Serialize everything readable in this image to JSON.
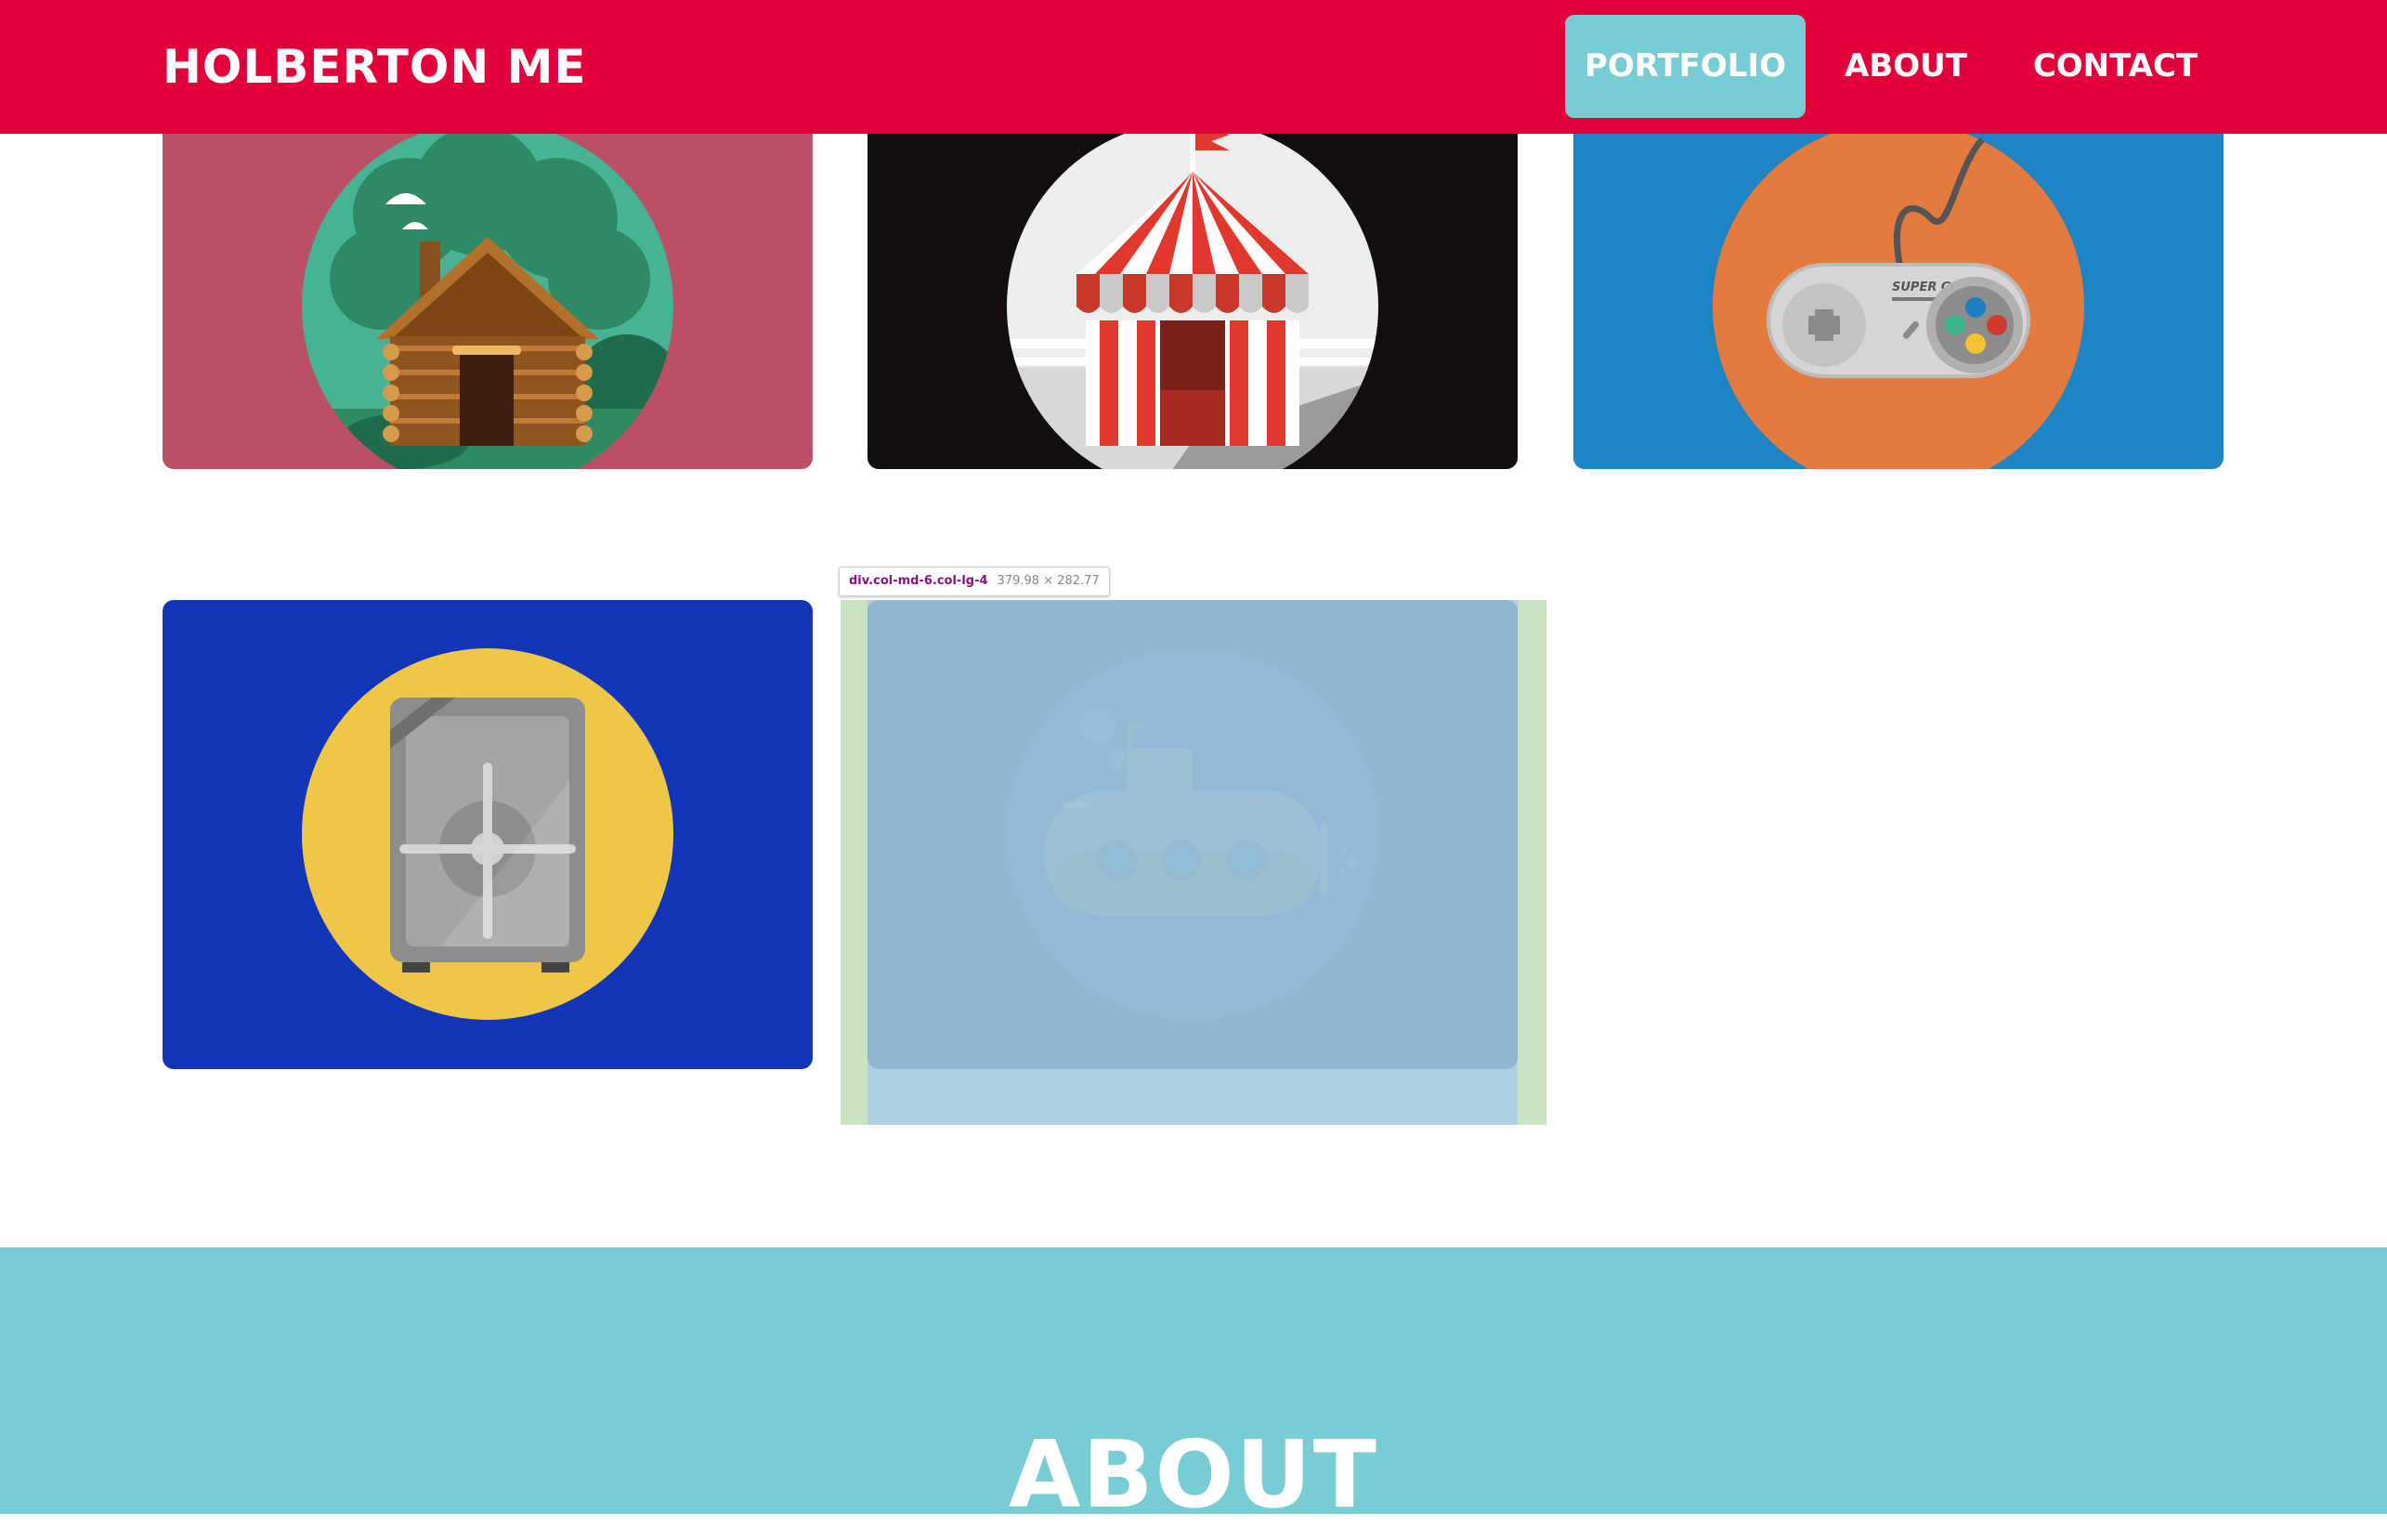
{
  "navbar": {
    "brand": "HOLBERTON ME",
    "links": [
      {
        "label": "PORTFOLIO",
        "active": true
      },
      {
        "label": "ABOUT",
        "active": false
      },
      {
        "label": "CONTACT",
        "active": false
      }
    ],
    "color": "#e1003a",
    "active_color": "#78ccd3"
  },
  "portfolio": {
    "cards": [
      {
        "icon": "log-cabin-icon",
        "background": "#bb4f63",
        "circle": "#45b394"
      },
      {
        "icon": "circus-tent-icon",
        "background": "#120f0e",
        "circle": "#eceeee"
      },
      {
        "icon": "game-controller-icon",
        "background": "#1e84c3",
        "circle": "#e37b3e",
        "controller_text": "SUPER GAME"
      },
      {
        "icon": "safe-icon",
        "background": "#1235b9",
        "circle": "#efc748"
      },
      {
        "icon": "submarine-icon",
        "background": "#1e4b7c",
        "circle": "#5586b3"
      }
    ]
  },
  "devtools": {
    "selector": "div.col-md-6.col-lg-4",
    "dimensions": "379.98 × 282.77"
  },
  "about": {
    "title": "ABOUT",
    "color": "#78ccd3"
  }
}
